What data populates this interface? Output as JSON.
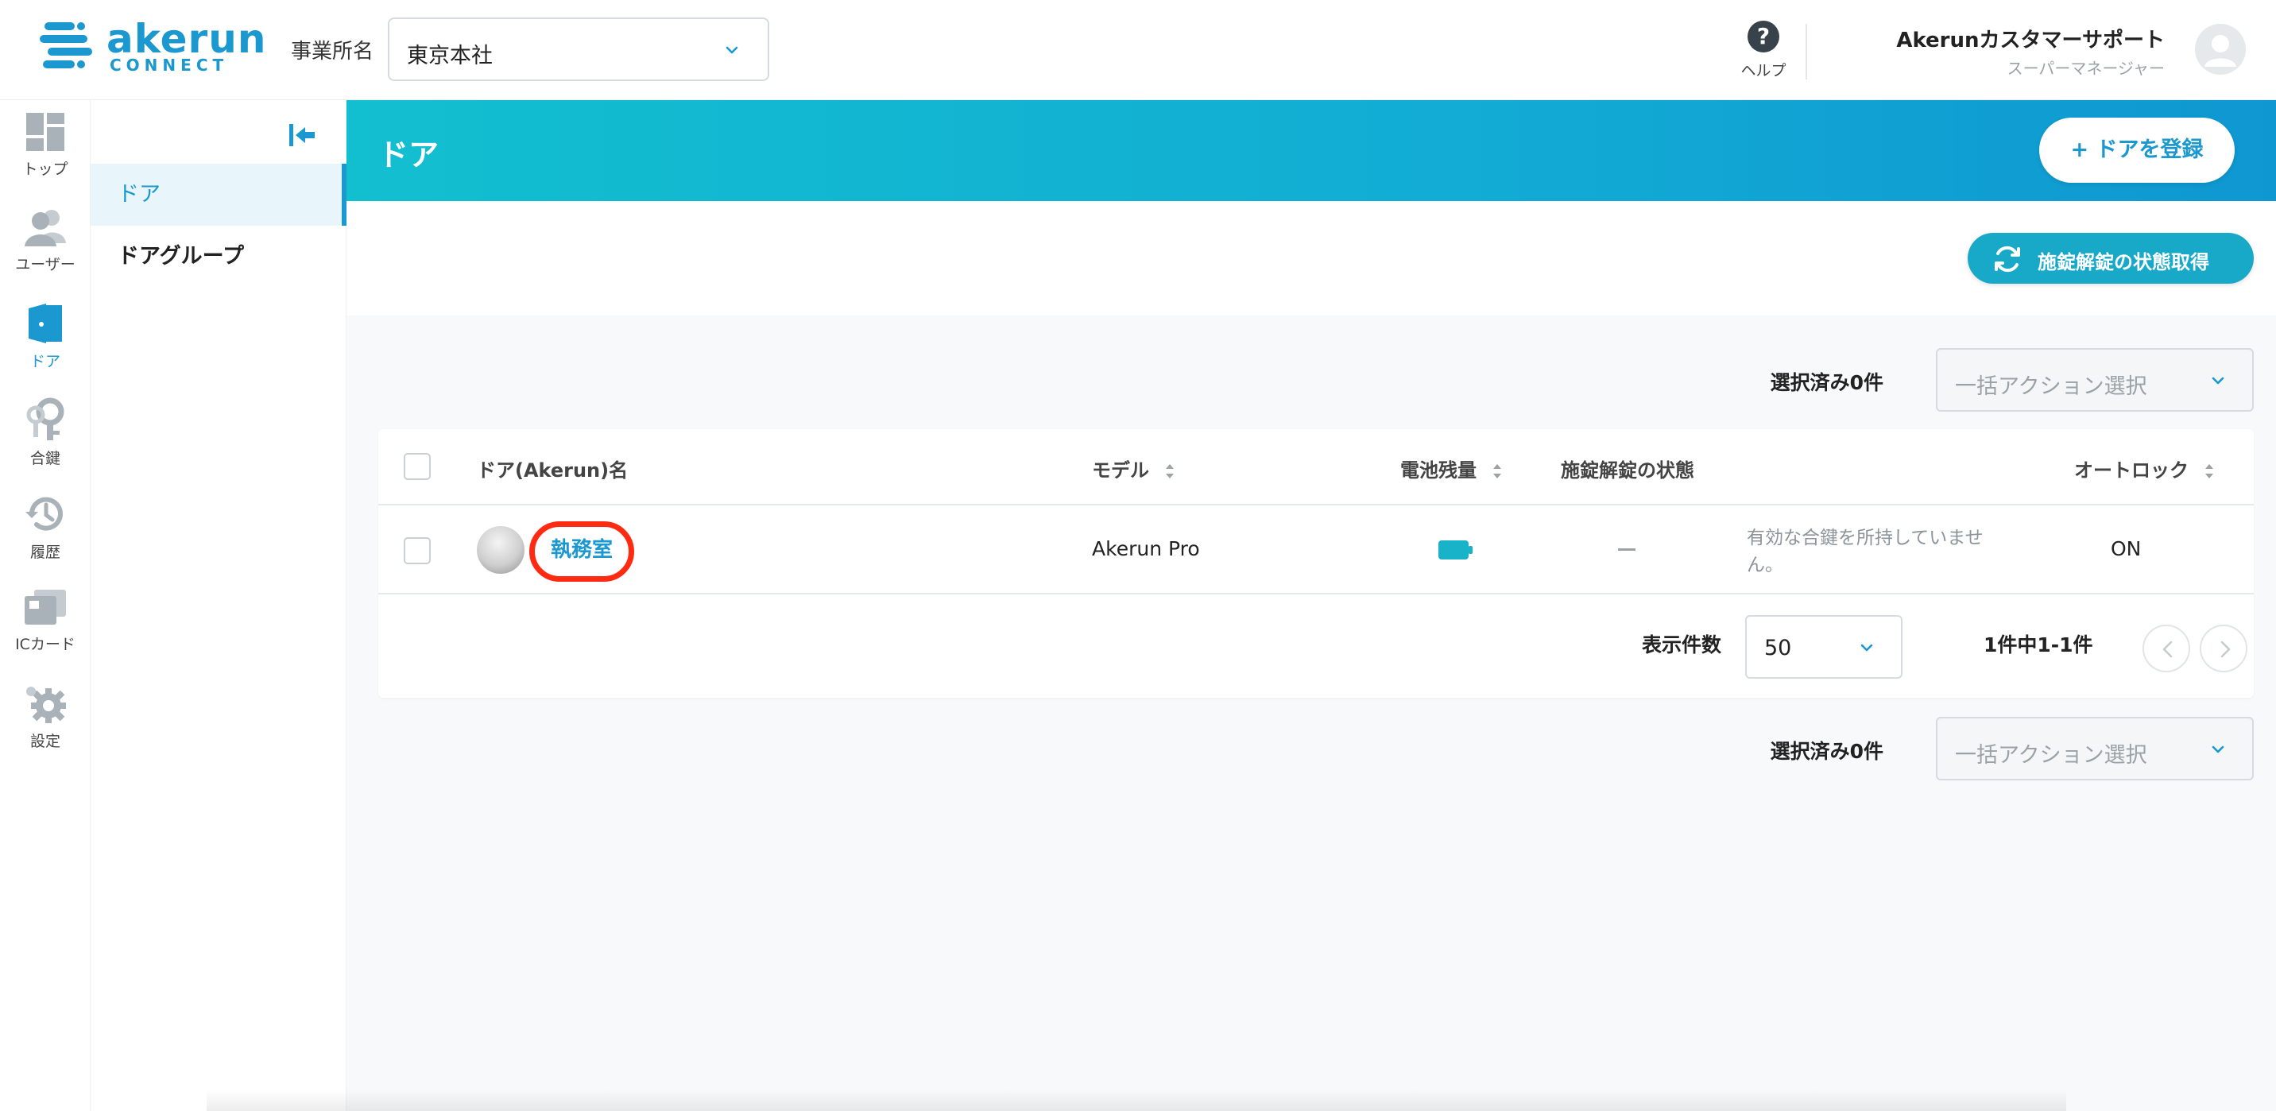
{
  "header": {
    "logo_text": "akerun",
    "logo_sub": "CONNECT",
    "office_label": "事業所名",
    "office_value": "東京本社",
    "help_label": "ヘルプ",
    "user_name": "Akerunカスタマーサポート",
    "user_role": "スーパーマネージャー"
  },
  "rail": {
    "items": [
      {
        "label": "トップ",
        "icon": "dashboard-icon"
      },
      {
        "label": "ユーザー",
        "icon": "users-icon"
      },
      {
        "label": "ドア",
        "icon": "door-icon"
      },
      {
        "label": "合鍵",
        "icon": "key-icon"
      },
      {
        "label": "履歴",
        "icon": "history-icon"
      },
      {
        "label": "ICカード",
        "icon": "ic-card-icon"
      },
      {
        "label": "設定",
        "icon": "gear-icon"
      }
    ],
    "active": "ドア"
  },
  "subnav": {
    "items": [
      {
        "label": "ドア"
      },
      {
        "label": "ドアグループ"
      }
    ]
  },
  "main": {
    "title": "ドア",
    "register_button": "ドアを登録",
    "register_plus": "+",
    "fetch_button": "施錠解錠の状態取得",
    "bulk_top": {
      "label": "選択済み0件",
      "placeholder": "一括アクション選択"
    },
    "bulk_bottom": {
      "label": "選択済み0件",
      "placeholder": "一括アクション選択"
    },
    "table": {
      "headers": [
        "ドア(Akerun)名",
        "モデル",
        "電池残量",
        "施錠解錠の状態",
        "オートロック"
      ],
      "rows": [
        {
          "name": "執務室",
          "model": "Akerun Pro",
          "battery_level": 1.0,
          "lock_state": "—",
          "note": "有効な合鍵を所持していません。",
          "autolock": "ON"
        }
      ]
    },
    "pager": {
      "label": "表示件数",
      "per_page": "50",
      "count": "1件中1-1件"
    }
  },
  "colors": {
    "brand": "#1b98cf",
    "banner_start": "#12bfcf",
    "banner_end": "#0f97d1",
    "highlight_ring": "#ff2a12",
    "battery": "#18b3c9"
  }
}
